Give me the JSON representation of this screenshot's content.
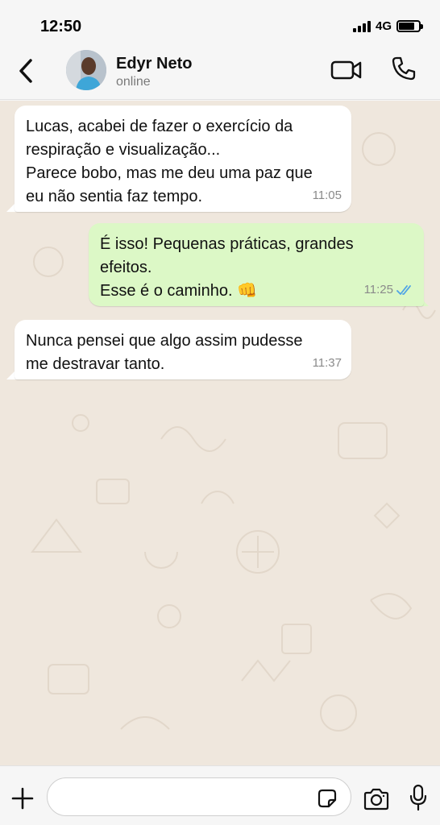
{
  "status_bar": {
    "time": "12:50",
    "network": "4G",
    "icons": [
      "signal-icon",
      "battery-icon"
    ]
  },
  "header": {
    "contact_name": "Edyr Neto",
    "contact_status": "online",
    "icons": [
      "back-arrow-icon",
      "avatar",
      "video-call-icon",
      "phone-call-icon"
    ]
  },
  "messages": [
    {
      "direction": "in",
      "lines": [
        "Lucas, acabei de fazer o exercício da",
        "respiração e visualização...",
        "Parece bobo, mas me deu uma paz que",
        "eu não sentia faz tempo."
      ],
      "time": "11:05"
    },
    {
      "direction": "out",
      "lines": [
        "É isso! Pequenas práticas, grandes",
        "efeitos.",
        "Esse é o caminho."
      ],
      "emoji": "👊",
      "time": "11:25",
      "read_receipt": "double-check-icon"
    },
    {
      "direction": "in",
      "lines": [
        "Nunca pensei que algo assim pudesse",
        "me destravar tanto."
      ],
      "time": "11:37"
    }
  ],
  "input_bar": {
    "placeholder": "",
    "icons": [
      "plus-icon",
      "sticker-icon",
      "camera-icon",
      "microphone-icon"
    ]
  },
  "colors": {
    "incoming_bubble": "#ffffff",
    "outgoing_bubble": "#dcf8c6",
    "chat_background": "#efe7dd",
    "read_receipt": "#4fa3e6"
  }
}
